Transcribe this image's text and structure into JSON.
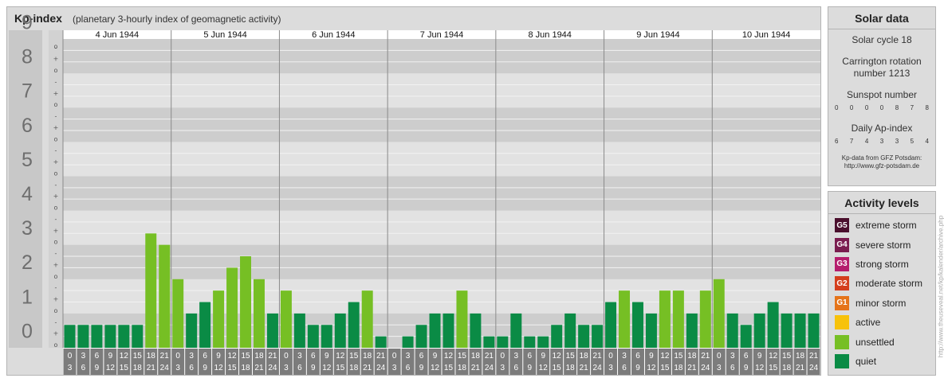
{
  "header": {
    "title": "Kp-index",
    "subtitle": "(planetary 3-hourly index of geomagnetic activity)"
  },
  "chart_data": {
    "type": "bar",
    "title": "Kp-index",
    "subtitle": "(planetary 3-hourly index of geomagnetic activity)",
    "ylim": [
      0,
      9
    ],
    "y_ticks": [
      "0",
      "1",
      "2",
      "3",
      "4",
      "5",
      "6",
      "7",
      "8",
      "9"
    ],
    "y_minor_labels": [
      "o",
      "+",
      "-"
    ],
    "days": [
      "4 Jun 1944",
      "5 Jun 1944",
      "6 Jun 1944",
      "7 Jun 1944",
      "8 Jun 1944",
      "9 Jun 1944",
      "10 Jun 1944"
    ],
    "slot_start_labels": [
      "0",
      "3",
      "6",
      "9",
      "12",
      "15",
      "18",
      "21"
    ],
    "slot_end_labels": [
      "3",
      "6",
      "9",
      "12",
      "15",
      "18",
      "21",
      "24"
    ],
    "values": [
      0.667,
      0.667,
      0.667,
      0.667,
      0.667,
      0.667,
      3.333,
      3.0,
      2.0,
      1.0,
      1.333,
      1.667,
      2.333,
      2.667,
      2.0,
      1.0,
      1.667,
      1.0,
      0.667,
      0.667,
      1.0,
      1.333,
      1.667,
      0.333,
      0.0,
      0.333,
      0.667,
      1.0,
      1.0,
      1.667,
      1.0,
      0.333,
      0.333,
      1.0,
      0.333,
      0.333,
      0.667,
      1.0,
      0.667,
      0.667,
      1.333,
      1.667,
      1.333,
      1.0,
      1.667,
      1.667,
      1.0,
      1.667,
      2.0,
      1.0,
      0.667,
      1.0,
      1.333,
      1.0,
      1.0,
      1.0
    ],
    "levels": [
      "quiet",
      "quiet",
      "quiet",
      "quiet",
      "quiet",
      "quiet",
      "unsettled",
      "unsettled",
      "unsettled",
      "quiet",
      "quiet",
      "unsettled",
      "unsettled",
      "unsettled",
      "unsettled",
      "quiet",
      "unsettled",
      "quiet",
      "quiet",
      "quiet",
      "quiet",
      "quiet",
      "unsettled",
      "quiet",
      "quiet",
      "quiet",
      "quiet",
      "quiet",
      "quiet",
      "unsettled",
      "quiet",
      "quiet",
      "quiet",
      "quiet",
      "quiet",
      "quiet",
      "quiet",
      "quiet",
      "quiet",
      "quiet",
      "quiet",
      "unsettled",
      "quiet",
      "quiet",
      "unsettled",
      "unsettled",
      "quiet",
      "unsettled",
      "unsettled",
      "quiet",
      "quiet",
      "quiet",
      "quiet",
      "quiet",
      "quiet",
      "quiet"
    ],
    "level_colors": {
      "quiet": "#0a8b45",
      "unsettled": "#76bf24"
    },
    "grid": true
  },
  "solar": {
    "title": "Solar data",
    "cycle": "Solar cycle 18",
    "carrington": "Carrington rotation number 1213",
    "sunspot_label": "Sunspot number",
    "sunspot_values": [
      "0",
      "0",
      "0",
      "0",
      "8",
      "7",
      "8"
    ],
    "ap_label": "Daily Ap-index",
    "ap_values": [
      "6",
      "7",
      "4",
      "3",
      "3",
      "5",
      "4"
    ],
    "source_line1": "Kp-data from GFZ Potsdam:",
    "source_line2": "http://www.gfz-potsdam.de"
  },
  "activity": {
    "title": "Activity levels",
    "items": [
      {
        "badge": "G5",
        "label": "extreme storm",
        "color": "#4a0f2d"
      },
      {
        "badge": "G4",
        "label": "severe storm",
        "color": "#7a1d4f"
      },
      {
        "badge": "G3",
        "label": "strong storm",
        "color": "#b51d6d"
      },
      {
        "badge": "G2",
        "label": "moderate storm",
        "color": "#d43e1d"
      },
      {
        "badge": "G1",
        "label": "minor storm",
        "color": "#e5741a"
      },
      {
        "badge": "",
        "label": "active",
        "color": "#f7c20a"
      },
      {
        "badge": "",
        "label": "unsettled",
        "color": "#76bf24"
      },
      {
        "badge": "",
        "label": "quiet",
        "color": "#0a8b45"
      }
    ]
  },
  "side_url": "http://www.theuseveal.net/kp/kalender/archive.php"
}
